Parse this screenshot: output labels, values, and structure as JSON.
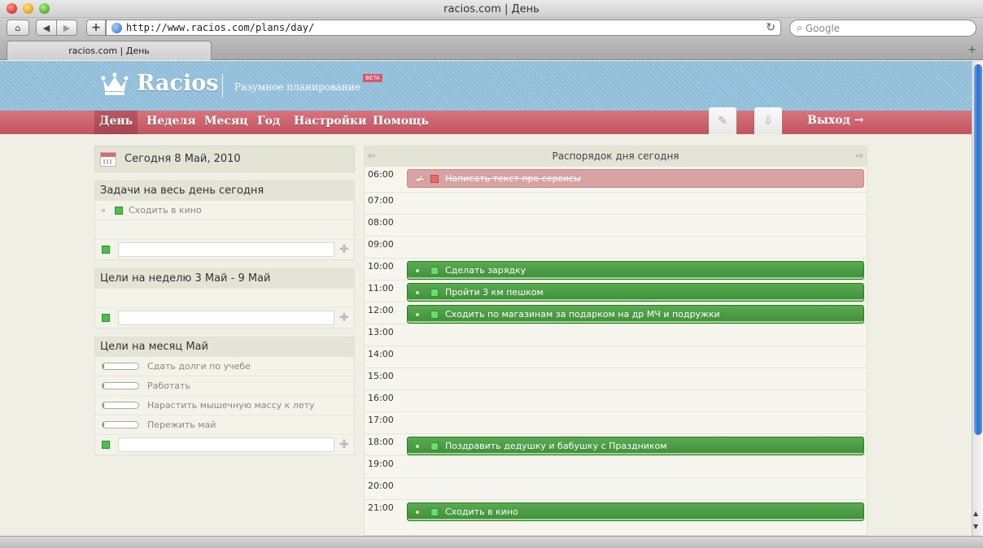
{
  "browser": {
    "window_title": "racios.com | День",
    "url": "http://www.racios.com/plans/day/",
    "search_placeholder": "Google",
    "tab_title": "racios.com | День"
  },
  "site": {
    "logo": "Racios",
    "tagline": "Разумное планирование",
    "beta": "BETA"
  },
  "nav": {
    "items": [
      "День",
      "Неделя",
      "Месяц",
      "Год",
      "Настройки",
      "Помощь"
    ],
    "active": "День",
    "exit": "Выход →"
  },
  "left": {
    "today": "Сегодня 8 Май, 2010",
    "all_day": {
      "title": "Задачи на весь день сегодня",
      "tasks": [
        "Сходить в кино"
      ]
    },
    "week": {
      "title": "Цели на неделю 3 Май - 9 Май"
    },
    "month": {
      "title": "Цели на месяц Май",
      "goals": [
        {
          "label": "Сдать долги по учебе",
          "progress": 0.05
        },
        {
          "label": "Работать",
          "progress": 0.05
        },
        {
          "label": "Нарастить мышечную массу к лету",
          "progress": 0.05
        },
        {
          "label": "Пережить май",
          "progress": 0.05
        }
      ]
    }
  },
  "schedule": {
    "title": "Распорядок дня сегодня",
    "hours": [
      "06:00",
      "07:00",
      "08:00",
      "09:00",
      "10:00",
      "11:00",
      "12:00",
      "13:00",
      "14:00",
      "15:00",
      "16:00",
      "17:00",
      "18:00",
      "19:00",
      "20:00",
      "21:00"
    ],
    "events": [
      {
        "hour": "06:00",
        "text": "Написать текст про сервисы",
        "done": true
      },
      {
        "hour": "10:00",
        "text": "Сделать зарядку",
        "done": false
      },
      {
        "hour": "11:00",
        "text": "Пройти 3 км пешком",
        "done": false
      },
      {
        "hour": "12:00",
        "text": "Сходить по магазинам за подарком на др МЧ и подружки",
        "done": false
      },
      {
        "hour": "18:00",
        "text": "Поздравить дедушку и бабушку с Праздником",
        "done": false
      },
      {
        "hour": "21:00",
        "text": "Сходить в кино",
        "done": false
      }
    ]
  }
}
